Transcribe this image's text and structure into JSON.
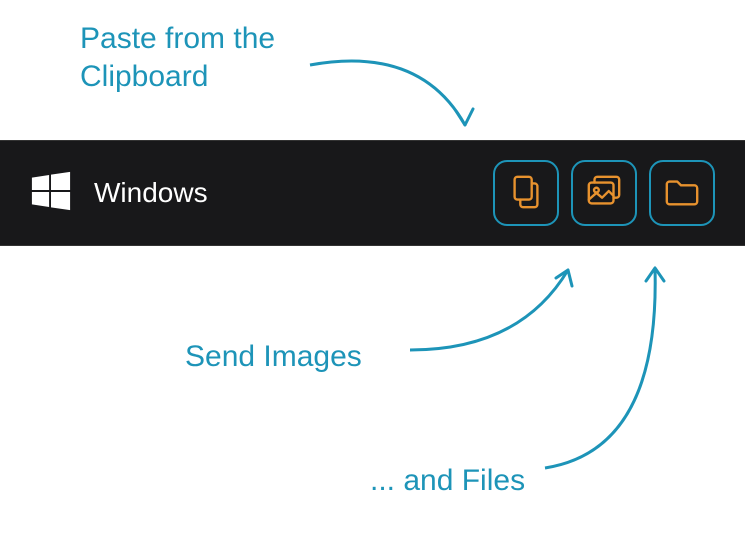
{
  "annotations": {
    "clipboard": "Paste from the\nClipboard",
    "images": "Send Images",
    "files": "... and Files"
  },
  "toolbar": {
    "device_label": "Windows"
  },
  "colors": {
    "accent_cyan": "#1d94b8",
    "icon_orange": "#e8922e",
    "toolbar_bg": "#18181a"
  },
  "icons": {
    "logo": "windows-logo-icon",
    "clipboard": "clipboard-icon",
    "images": "images-icon",
    "files": "folder-icon"
  }
}
